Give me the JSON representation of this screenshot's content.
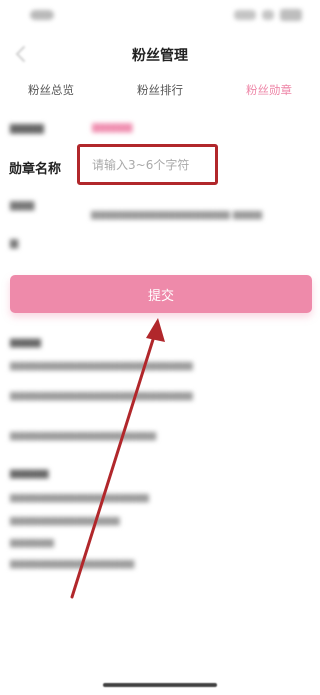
{
  "header": {
    "title": "粉丝管理",
    "back_icon": "chevron-left-icon"
  },
  "tabs": [
    {
      "label": "粉丝总览",
      "active": false
    },
    {
      "label": "粉丝排行",
      "active": false
    },
    {
      "label": "粉丝勋章",
      "active": true
    }
  ],
  "form": {
    "medal_name_label": "勋章名称",
    "medal_name_placeholder": "请输入3~6个字符",
    "medal_name_value": ""
  },
  "submit": {
    "label": "提交"
  },
  "annotation": {
    "arrow_color": "#b1272b",
    "highlight_color": "#b1272b"
  },
  "colors": {
    "accent": "#ee8aaa",
    "active_tab": "#ee87a8"
  }
}
